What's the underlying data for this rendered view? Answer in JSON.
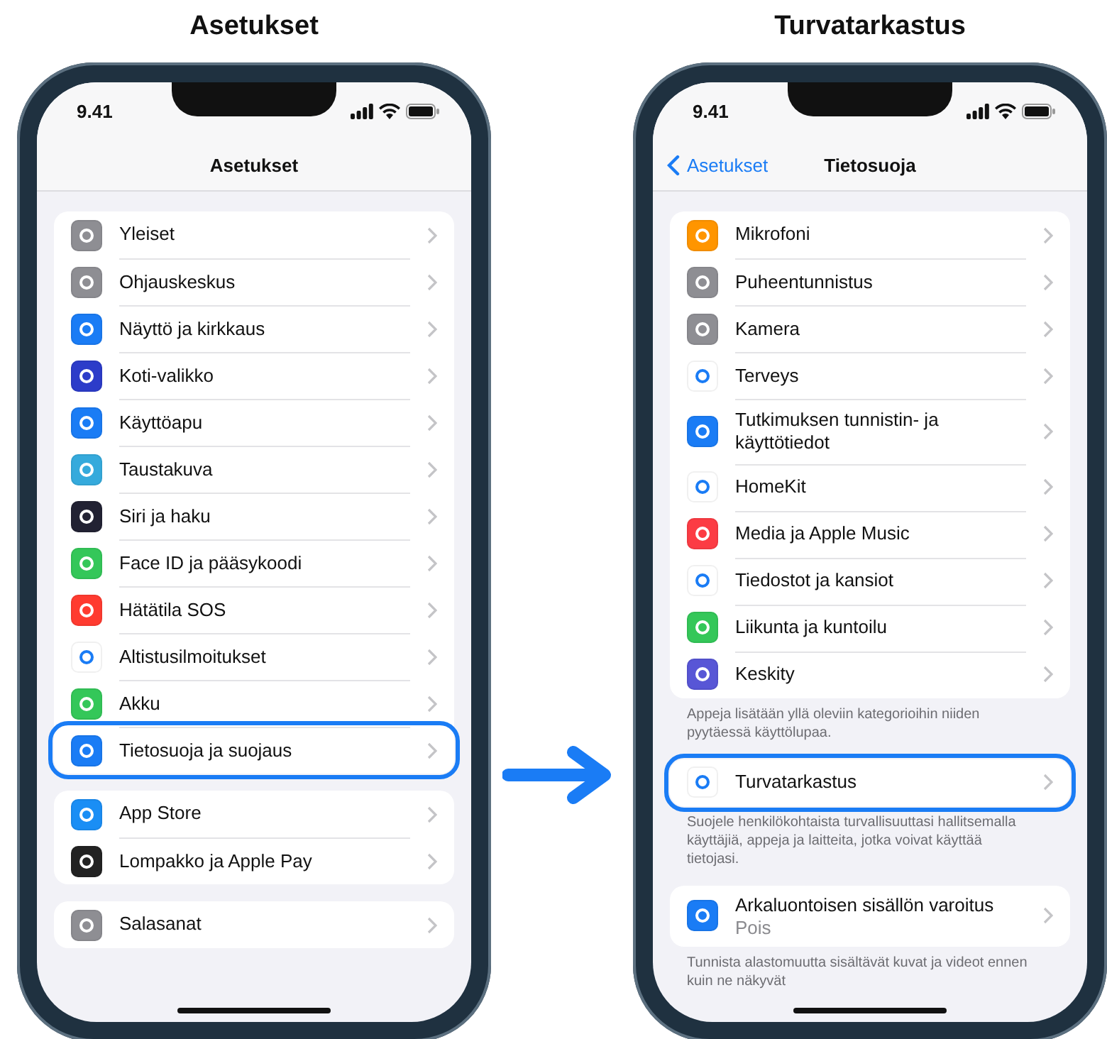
{
  "phones": [
    {
      "heading": "Asetukset",
      "time": "9.41",
      "nav": {
        "title": "Asetukset"
      },
      "sections": [
        {
          "rows": [
            {
              "label": "Yleiset",
              "color": "#8e8e93",
              "highlighted": false
            },
            {
              "label": "Ohjauskeskus",
              "color": "#8e8e93",
              "highlighted": false
            },
            {
              "label": "Näyttö ja kirkkaus",
              "color": "#1a7cf5",
              "highlighted": false
            },
            {
              "label": "Koti-valikko",
              "color": "#2c3cc9",
              "highlighted": false
            },
            {
              "label": "Käyttöapu",
              "color": "#1a7cf5",
              "highlighted": false
            },
            {
              "label": "Taustakuva",
              "color": "#35aadc",
              "highlighted": false
            },
            {
              "label": "Siri ja haku",
              "color": "#222233",
              "highlighted": false
            },
            {
              "label": "Face ID ja pääsykoodi",
              "color": "#34c759",
              "highlighted": false
            },
            {
              "label": "Hätätila SOS",
              "color": "#ff3b30",
              "highlighted": false
            },
            {
              "label": "Altistusilmoitukset",
              "color": "#ffffff",
              "highlighted": false
            },
            {
              "label": "Akku",
              "color": "#34c759",
              "highlighted": false
            },
            {
              "label": "Tietosuoja ja suojaus",
              "color": "#1a7cf5",
              "highlighted": true
            }
          ]
        },
        {
          "rows": [
            {
              "label": "App Store",
              "color": "#1a8ef5",
              "highlighted": false
            },
            {
              "label": "Lompakko ja Apple Pay",
              "color": "#222222",
              "highlighted": false
            }
          ]
        },
        {
          "rows": [
            {
              "label": "Salasanat",
              "color": "#8e8e93",
              "highlighted": false
            }
          ]
        }
      ]
    },
    {
      "heading": "Turvatarkastus",
      "time": "9.41",
      "nav": {
        "back": "Asetukset",
        "title": "Tietosuoja"
      },
      "sections": [
        {
          "rows": [
            {
              "label": "Mikrofoni",
              "color": "#ff9500",
              "highlighted": false
            },
            {
              "label": "Puheentunnistus",
              "color": "#8e8e93",
              "highlighted": false
            },
            {
              "label": "Kamera",
              "color": "#8e8e93",
              "highlighted": false
            },
            {
              "label": "Terveys",
              "color": "#ffffff",
              "highlighted": false
            },
            {
              "label": "Tutkimuksen tunnistin- ja käyttötiedot",
              "color": "#1a7cf5",
              "highlighted": false
            },
            {
              "label": "HomeKit",
              "color": "#ffffff",
              "highlighted": false
            },
            {
              "label": "Media ja Apple Music",
              "color": "#fc3c44",
              "highlighted": false
            },
            {
              "label": "Tiedostot ja kansiot",
              "color": "#ffffff",
              "highlighted": false
            },
            {
              "label": "Liikunta ja kuntoilu",
              "color": "#34c759",
              "highlighted": false
            },
            {
              "label": "Keskity",
              "color": "#5856d6",
              "highlighted": false
            }
          ],
          "footer": "Appeja lisätään yllä oleviin kategorioihin niiden pyytäessä käyttölupaa."
        },
        {
          "rows": [
            {
              "label": "Turvatarkastus",
              "color": "#ffffff",
              "highlighted": true
            }
          ],
          "footer": "Suojele henkilökohtaista turvallisuuttasi hallitsemalla käyttäjiä, appeja ja laitteita, jotka voivat käyttää tietojasi."
        },
        {
          "rows": [
            {
              "label": "Arkaluontoisen sisällön varoitus",
              "sublabel": "Pois",
              "color": "#1a7cf5",
              "highlighted": false
            }
          ],
          "footer": "Tunnista alastomuutta sisältävät kuvat ja videot ennen kuin ne näkyvät"
        }
      ]
    }
  ]
}
